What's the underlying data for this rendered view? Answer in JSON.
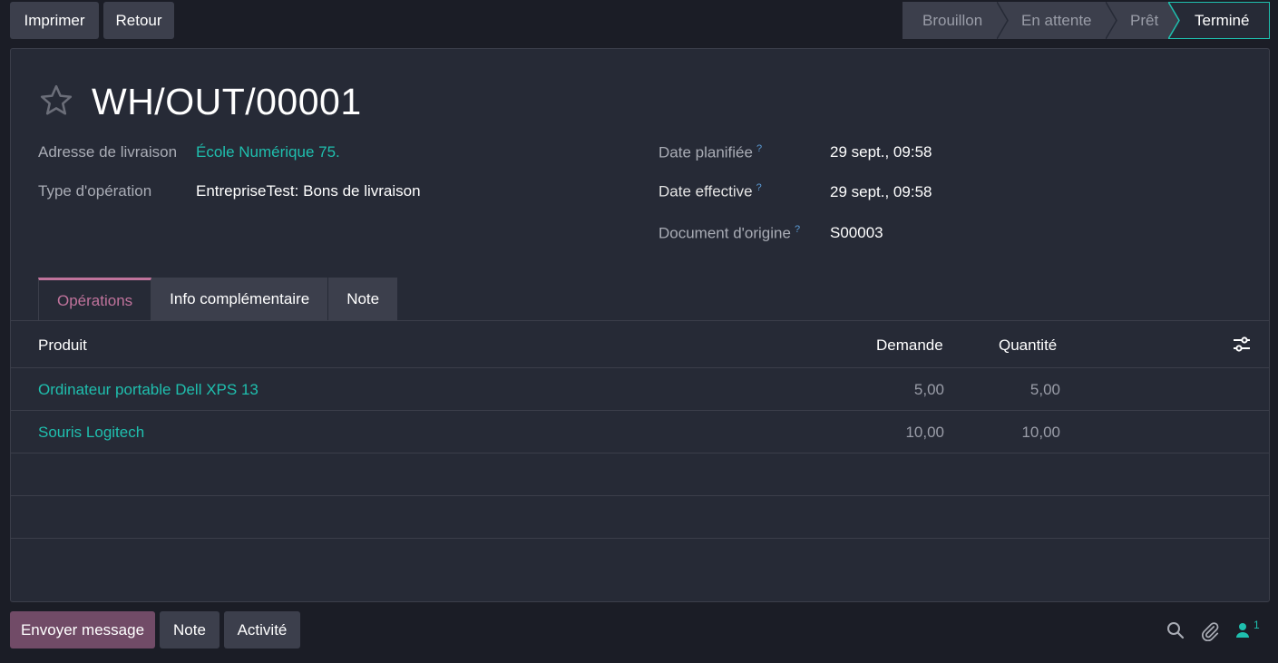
{
  "toolbar": {
    "print_label": "Imprimer",
    "back_label": "Retour"
  },
  "status": {
    "stages": [
      "Brouillon",
      "En attente",
      "Prêt",
      "Terminé"
    ],
    "current": "Terminé",
    "accent": "#1fbfae"
  },
  "record": {
    "title": "WH/OUT/00001",
    "star_icon": "star-icon",
    "fields": {
      "delivery_address_label": "Adresse de livraison",
      "delivery_address_value": "École Numérique 75.",
      "operation_type_label": "Type d'opération",
      "operation_type_value": "EntrepriseTest: Bons de livraison",
      "scheduled_date_label": "Date planifiée",
      "scheduled_date_value": "29 sept., 09:58",
      "effective_date_label": "Date effective",
      "effective_date_value": "29 sept., 09:58",
      "origin_label": "Document d'origine",
      "origin_value": "S00003",
      "help_mark": "?"
    }
  },
  "tabs": [
    {
      "label": "Opérations"
    },
    {
      "label": "Info complémentaire"
    },
    {
      "label": "Note"
    }
  ],
  "table": {
    "headers": {
      "product": "Produit",
      "demand": "Demande",
      "quantity": "Quantité"
    },
    "rows": [
      {
        "product": "Ordinateur portable Dell XPS 13",
        "demand": "5,00",
        "quantity": "5,00"
      },
      {
        "product": "Souris Logitech",
        "demand": "10,00",
        "quantity": "10,00"
      }
    ]
  },
  "chatter": {
    "send_message_label": "Envoyer message",
    "note_label": "Note",
    "activity_label": "Activité",
    "followers_count": "1"
  },
  "colors": {
    "accent": "#1fbfae",
    "brand": "#714b67",
    "tab_active": "#c0739c"
  }
}
